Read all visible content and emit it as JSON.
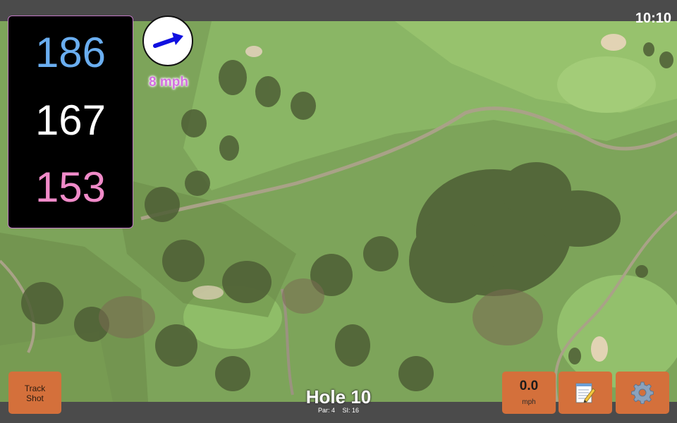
{
  "status_bar": {
    "time": "10:10"
  },
  "distances": {
    "back": "186",
    "center": "167",
    "front": "153"
  },
  "wind": {
    "speed_label": "8 mph",
    "direction_icon": "arrow-icon"
  },
  "hole": {
    "title": "Hole 10",
    "par": "Par: 4",
    "stroke_index": "SI: 16"
  },
  "buttons": {
    "track_shot": {
      "line1": "Track",
      "line2": "Shot"
    },
    "speed": {
      "value": "0.0",
      "unit": "mph"
    },
    "notes_icon": "notepad-icon",
    "settings_icon": "gear-icon"
  },
  "colors": {
    "back_distance": "#6aaef0",
    "center_distance": "#ffffff",
    "front_distance": "#f08ac8",
    "button_bg": "#d4703b",
    "wind_text": "#d36ee0"
  }
}
